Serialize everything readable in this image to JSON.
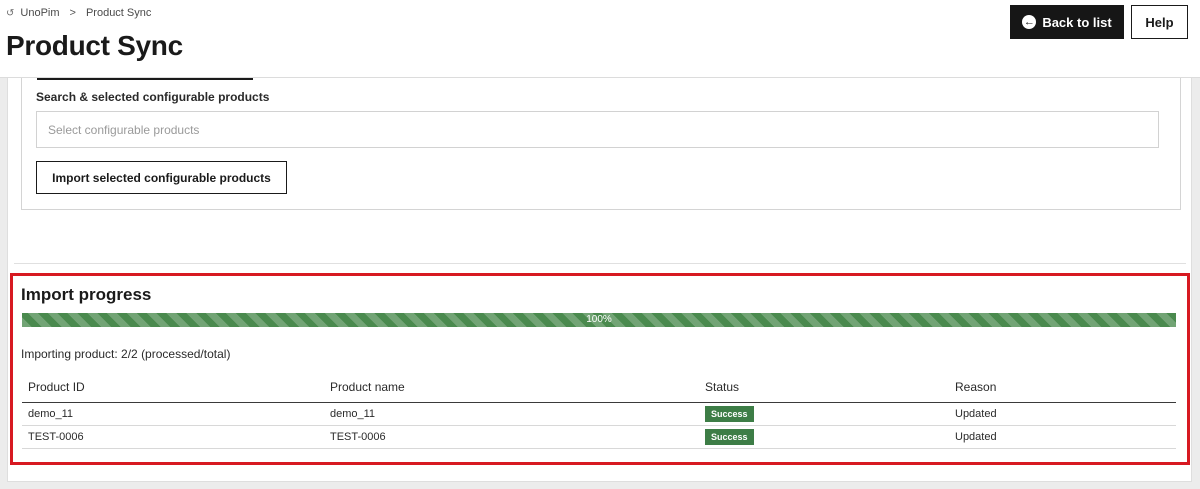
{
  "breadcrumb": {
    "root": "UnoPim",
    "separator": ">",
    "current": "Product Sync"
  },
  "page": {
    "title": "Product Sync"
  },
  "header_actions": {
    "back_label": "Back to list",
    "help_label": "Help"
  },
  "configurable": {
    "label": "Search & selected configurable products",
    "placeholder": "Select configurable products",
    "import_button": "Import selected configurable products"
  },
  "progress": {
    "title": "Import progress",
    "percent": 100,
    "percent_label": "100%",
    "status_text": "Importing product: 2/2 (processed/total)",
    "bar_color": "#4a8a4e"
  },
  "table": {
    "columns": [
      "Product ID",
      "Product name",
      "Status",
      "Reason"
    ],
    "rows": [
      {
        "id": "demo_11",
        "name": "demo_11",
        "status": "Success",
        "reason": "Updated"
      },
      {
        "id": "TEST-0006",
        "name": "TEST-0006",
        "status": "Success",
        "reason": "Updated"
      }
    ]
  },
  "colors": {
    "success_badge": "#3d7d46",
    "highlight_border": "#d71921",
    "primary_button": "#161616"
  }
}
